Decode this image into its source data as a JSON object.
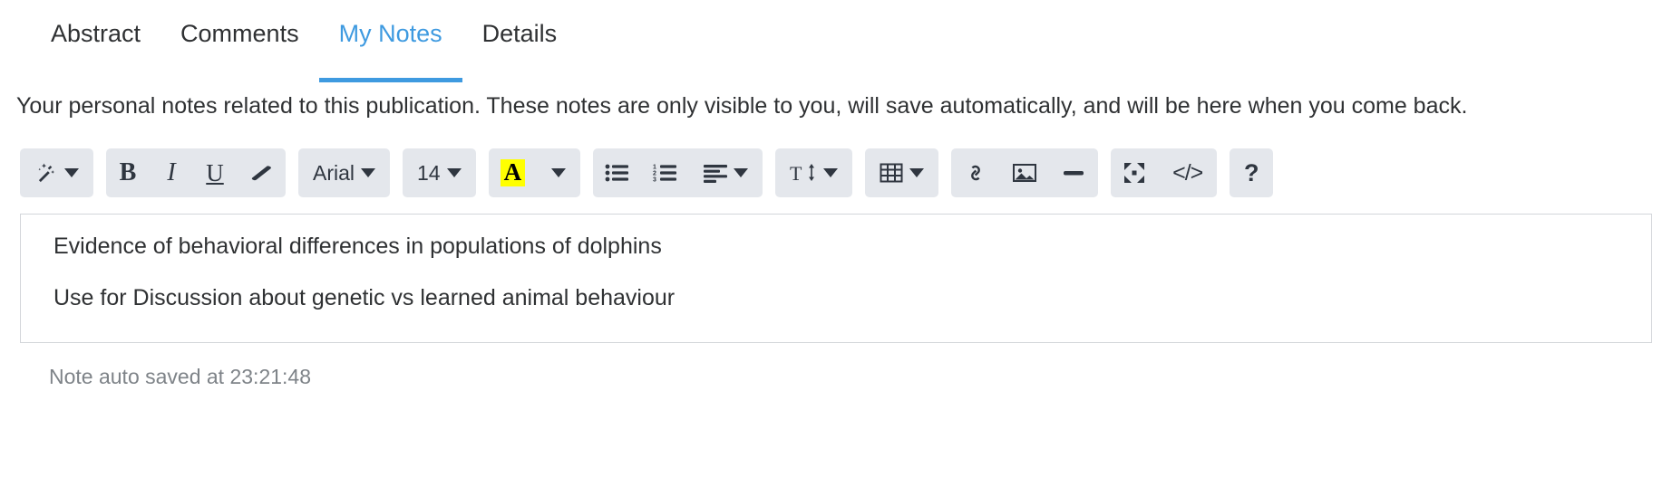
{
  "tabs": [
    {
      "label": "Abstract",
      "active": false
    },
    {
      "label": "Comments",
      "active": false
    },
    {
      "label": "My Notes",
      "active": true
    },
    {
      "label": "Details",
      "active": false
    }
  ],
  "description": "Your personal notes related to this publication. These notes are only visible to you, will save automatically, and will be here when you come back.",
  "toolbar": {
    "groups": [
      {
        "buttons": [
          {
            "icon": "magic-wand-icon",
            "label": "",
            "caret": true
          }
        ]
      },
      {
        "buttons": [
          {
            "icon": "bold-icon",
            "label": "B",
            "caret": false
          },
          {
            "icon": "italic-icon",
            "label": "I",
            "caret": false
          },
          {
            "icon": "underline-icon",
            "label": "U",
            "caret": false
          },
          {
            "icon": "eraser-icon",
            "label": "",
            "caret": false
          }
        ]
      },
      {
        "buttons": [
          {
            "icon": "font-family-icon",
            "label": "Arial",
            "caret": true
          }
        ]
      },
      {
        "buttons": [
          {
            "icon": "font-size-icon",
            "label": "14",
            "caret": true
          }
        ]
      },
      {
        "buttons": [
          {
            "icon": "text-color-icon",
            "label": "A",
            "caret": true
          }
        ]
      },
      {
        "buttons": [
          {
            "icon": "bullet-list-icon",
            "label": "",
            "caret": false
          },
          {
            "icon": "numbered-list-icon",
            "label": "",
            "caret": false
          },
          {
            "icon": "align-icon",
            "label": "",
            "caret": true
          }
        ]
      },
      {
        "buttons": [
          {
            "icon": "line-height-icon",
            "label": "",
            "caret": true
          }
        ]
      },
      {
        "buttons": [
          {
            "icon": "table-icon",
            "label": "",
            "caret": true
          }
        ]
      },
      {
        "buttons": [
          {
            "icon": "link-icon",
            "label": "",
            "caret": false
          },
          {
            "icon": "image-icon",
            "label": "",
            "caret": false
          },
          {
            "icon": "horizontal-rule-icon",
            "label": "",
            "caret": false
          }
        ]
      },
      {
        "buttons": [
          {
            "icon": "fullscreen-icon",
            "label": "",
            "caret": false
          },
          {
            "icon": "code-view-icon",
            "label": "</>",
            "caret": false
          }
        ]
      },
      {
        "buttons": [
          {
            "icon": "help-icon",
            "label": "?",
            "caret": false
          }
        ]
      }
    ],
    "font_family_value": "Arial",
    "font_size_value": "14",
    "text_color_letter": "A",
    "code_view_label": "</>",
    "help_label": "?",
    "bold_label": "B",
    "italic_label": "I",
    "underline_label": "U"
  },
  "editor": {
    "lines": [
      "Evidence of behavioral differences in populations of dolphins",
      "Use for Discussion about genetic vs learned animal behaviour"
    ]
  },
  "status": {
    "autosave_text": "Note auto saved at 23:21:48"
  },
  "colors": {
    "accent": "#3e9ae0",
    "toolbar_bg": "#e4e7ec",
    "icon": "#2f3640",
    "highlight": "#ffff00",
    "editor_border": "#d3d6da",
    "status_text": "#7e8388",
    "body_text": "#2f3133"
  }
}
